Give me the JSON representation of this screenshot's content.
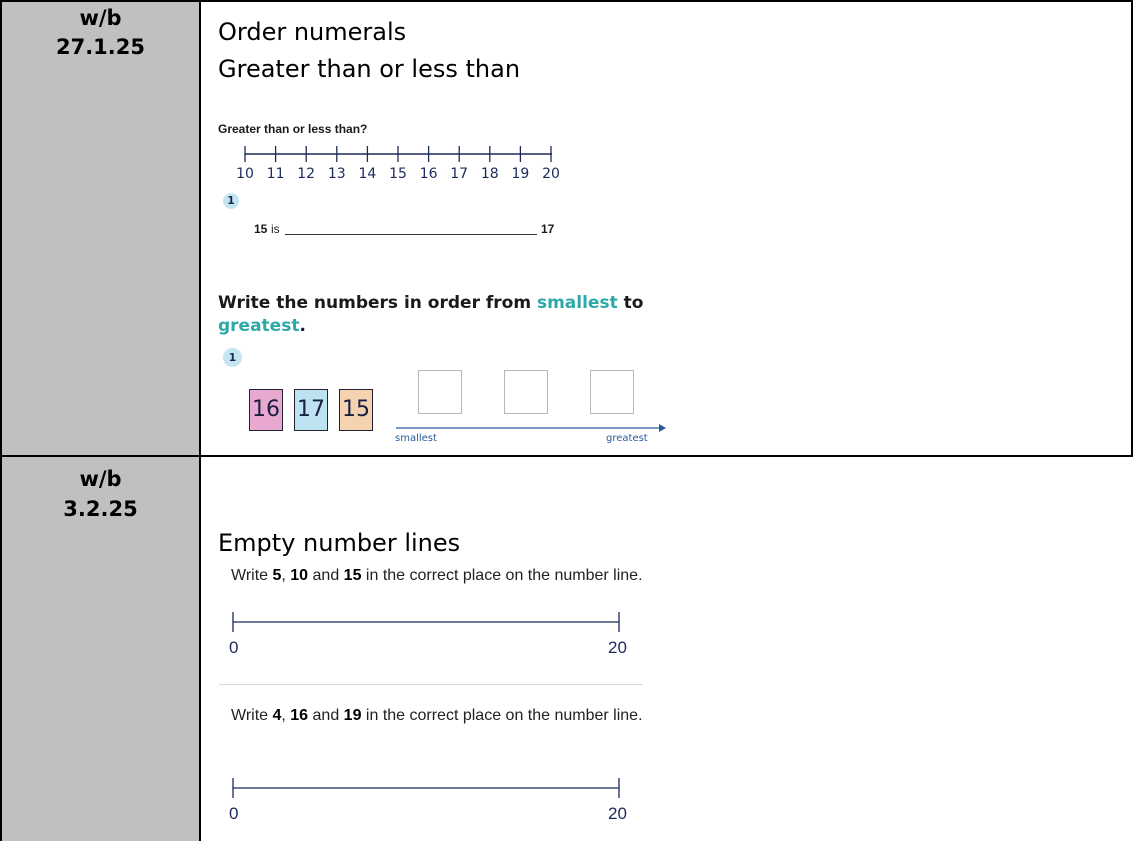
{
  "rows": [
    {
      "week_prefix": "w/b",
      "week_date": "27.1.25",
      "topics": [
        "Order numerals",
        "Greater than or less than"
      ],
      "worksheet": {
        "title": "Greater than or less than?",
        "number_line_ticks": [
          "10",
          "11",
          "12",
          "13",
          "14",
          "15",
          "16",
          "17",
          "18",
          "19",
          "20"
        ],
        "question_number": "1",
        "comparison": {
          "left": "15",
          "is_word": "is",
          "right": "17"
        },
        "order_heading": {
          "part1": "Write the numbers in order from ",
          "smallest": "smallest",
          "part2": " to",
          "greatest": "greatest",
          "period": "."
        },
        "order_question_number": "1",
        "cards": [
          {
            "value": "16",
            "color": "#e9a8d0"
          },
          {
            "value": "17",
            "color": "#bde3f0"
          },
          {
            "value": "15",
            "color": "#f5d2b0"
          }
        ],
        "arrow_left_label": "smallest",
        "arrow_right_label": "greatest"
      }
    },
    {
      "week_prefix": "w/b",
      "week_date": "3.2.25",
      "topic": "Empty number lines",
      "exercises": [
        {
          "n1": "5",
          "n2": "10",
          "n3": "15",
          "start": "0",
          "end": "20"
        },
        {
          "n1": "4",
          "n2": "16",
          "n3": "19",
          "start": "0",
          "end": "20"
        }
      ],
      "instruction_words": {
        "write": "Write ",
        "comma": ", ",
        "and": " and ",
        "rest": " in the correct place on the number line."
      }
    }
  ],
  "colors": {
    "week_cell_bg": "#c0c0c0",
    "teal": "#2fa8a8",
    "navy": "#1c2a5a"
  }
}
